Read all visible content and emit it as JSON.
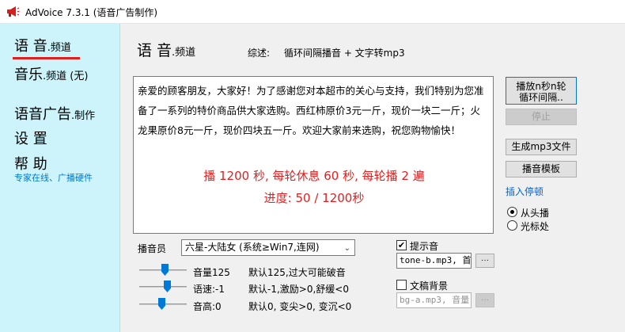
{
  "window": {
    "title": "AdVoice 7.3.1 (语音广告制作)"
  },
  "sidebar": {
    "voice": {
      "big": "语 音",
      "small": ".频道"
    },
    "music": {
      "big": "音乐",
      "small": ".频道 (无)"
    },
    "ad": {
      "big": "语音广告",
      "small": ".制作"
    },
    "settings": "设 置",
    "help": "帮 助",
    "help_sub": "专家在线、广播硬件"
  },
  "main": {
    "title": {
      "big": "语 音",
      "small": ".频道"
    },
    "summary_label": "综述:",
    "summary_text": "循环间隔播音 + 文字转mp3",
    "content": "亲爱的顾客朋友，大家好！为了感谢您对本超市的关心与支持，我们特别为您准备了一系列的特价商品供大家选购。西红柿原价3元一斤，现价一块二一斤；火龙果原价8元一斤，现价四块五一斤。欢迎大家前来选购，祝您购物愉快！",
    "play_info": "播 1200 秒, 每轮休息 60 秒, 每轮播 2 遍",
    "progress_info": "进度:  50 / 1200秒",
    "progress": {
      "current": 50,
      "total": 1200
    }
  },
  "controls": {
    "play_button": "播放n秒n轮\n循环间隔..",
    "stop_button": "停止",
    "mp3_button": "生成mp3文件",
    "template_button": "播音模板",
    "insert_pause": "插入停顿",
    "radio_from_start": "从头播",
    "radio_cursor": "光标处"
  },
  "announcer": {
    "label": "播音员",
    "selected": "六星-大陆女 (系统≥Win7,连网)"
  },
  "sliders": {
    "volume": {
      "label": "音量125",
      "note": "默认125,过大可能破音",
      "level": 0.55
    },
    "speed": {
      "label": "语速:-1",
      "note": "默认-1,激励>0,舒缓<0",
      "level": 0.6
    },
    "pitch": {
      "label": "音高:0",
      "note": "默认0, 变尖>0, 变沉<0",
      "level": 0.47
    }
  },
  "tone": {
    "label": "提示音",
    "checked": true,
    "file": "tone-b.mp3, 首",
    "browse": "···"
  },
  "background": {
    "label": "文稿背景",
    "checked": false,
    "file": "bg-a.mp3, 音量",
    "browse": "···"
  },
  "colors": {
    "sidebar_bg": "#cdf3fb",
    "accent_red": "#e02020",
    "link_blue": "#0078c8",
    "slider_blue": "#0078d7"
  }
}
